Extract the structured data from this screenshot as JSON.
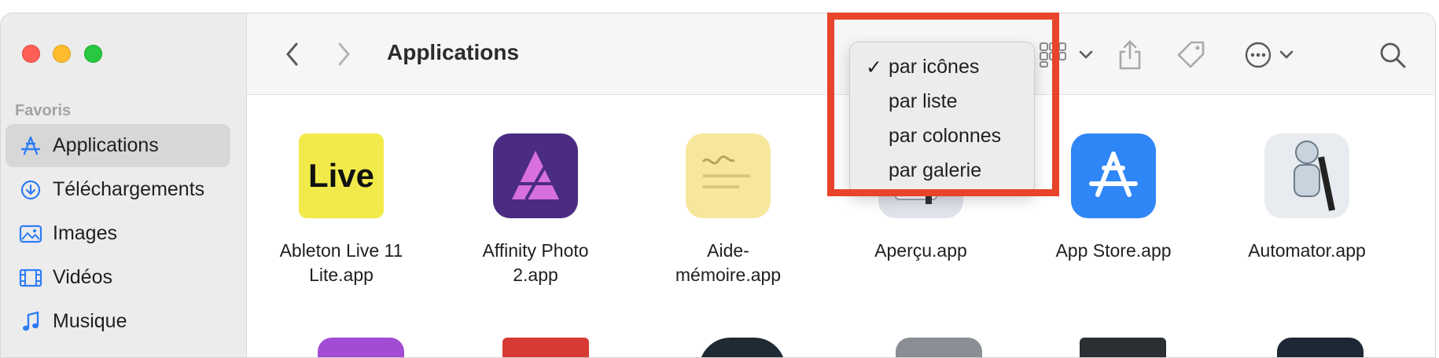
{
  "window": {
    "title": "Applications"
  },
  "sidebar": {
    "section": "Favoris",
    "items": [
      {
        "label": "Applications",
        "icon": "applications-icon",
        "selected": true
      },
      {
        "label": "Téléchargements",
        "icon": "downloads-icon"
      },
      {
        "label": "Images",
        "icon": "images-icon"
      },
      {
        "label": "Vidéos",
        "icon": "videos-icon"
      },
      {
        "label": "Musique",
        "icon": "music-icon"
      }
    ]
  },
  "view_menu": {
    "items": [
      {
        "label": "par icônes",
        "checked": true
      },
      {
        "label": "par liste"
      },
      {
        "label": "par colonnes"
      },
      {
        "label": "par galerie"
      }
    ],
    "check_mark": "✓"
  },
  "apps": [
    {
      "name": "Ableton Live 11 Lite.app",
      "line1": "Ableton Live 11",
      "line2": "Lite.app",
      "icon_text": "Live"
    },
    {
      "name": "Affinity Photo 2.app",
      "line1": "Affinity Photo",
      "line2": "2.app"
    },
    {
      "name": "Aide-mémoire.app",
      "line1": "Aide-",
      "line2": "mémoire.app"
    },
    {
      "name": "Aperçu.app",
      "line1": "Aperçu.app",
      "line2": ""
    },
    {
      "name": "App Store.app",
      "line1": "App Store.app",
      "line2": ""
    },
    {
      "name": "Automator.app",
      "line1": "Automator.app",
      "line2": ""
    }
  ],
  "colors": {
    "accent": "#2f7cf6",
    "highlight": "#e8442c"
  }
}
